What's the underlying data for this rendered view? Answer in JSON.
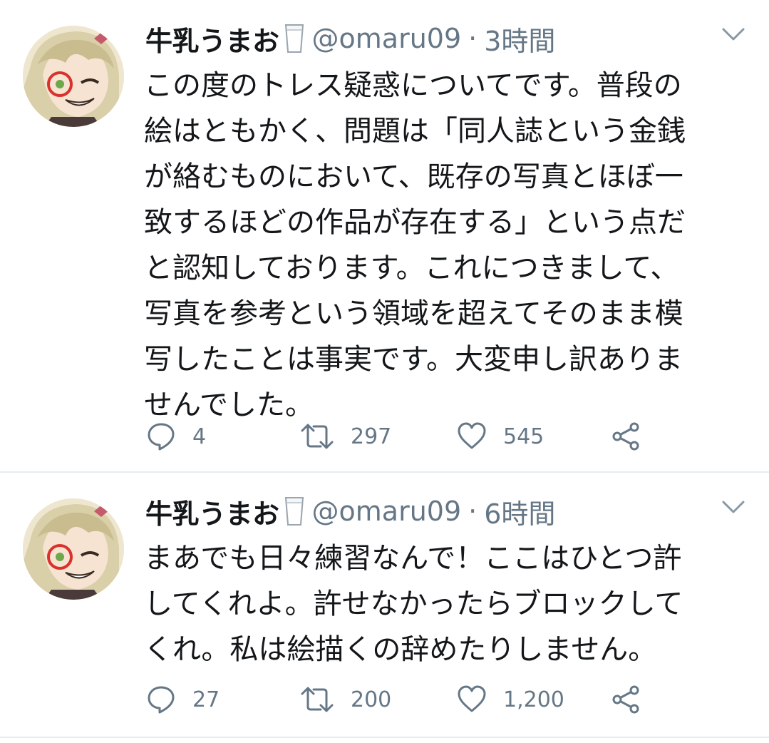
{
  "tweets": [
    {
      "display_name": "牛乳うまお",
      "handle": "@omaru09",
      "separator": "·",
      "time": "3時間",
      "text_lines": [
        "この度のトレス疑惑についてです。普段の",
        "絵はともかく、問題は「同人誌という金銭",
        "が絡むものにおいて、既存の写真とほぼ一",
        "致するほどの作品が存在する」という点だ",
        "と認知しております。これにつきまして、",
        "写真を参考という領域を超えてそのまま模",
        "写したことは事実です。大変申し訳ありま",
        "せんでした。"
      ],
      "replies": "4",
      "retweets": "297",
      "likes": "545"
    },
    {
      "display_name": "牛乳うまお",
      "handle": "@omaru09",
      "separator": "·",
      "time": "6時間",
      "text_lines": [
        "まあでも日々練習なんで！ここはひとつ許",
        "してくれよ。許せなかったらブロックして",
        "くれ。私は絵描くの辞めたりしません。"
      ],
      "replies": "27",
      "retweets": "200",
      "likes": "1,200"
    }
  ],
  "icons": {
    "reply": "speech-bubble-icon",
    "retweet": "retweet-arrows-icon",
    "like": "heart-icon",
    "share": "share-nodes-icon",
    "caret": "chevron-down-icon",
    "glass": "milk-glass-icon"
  },
  "colors": {
    "text": "#14171a",
    "secondary": "#657786",
    "divider": "#e6ecf0",
    "background": "#ffffff"
  }
}
